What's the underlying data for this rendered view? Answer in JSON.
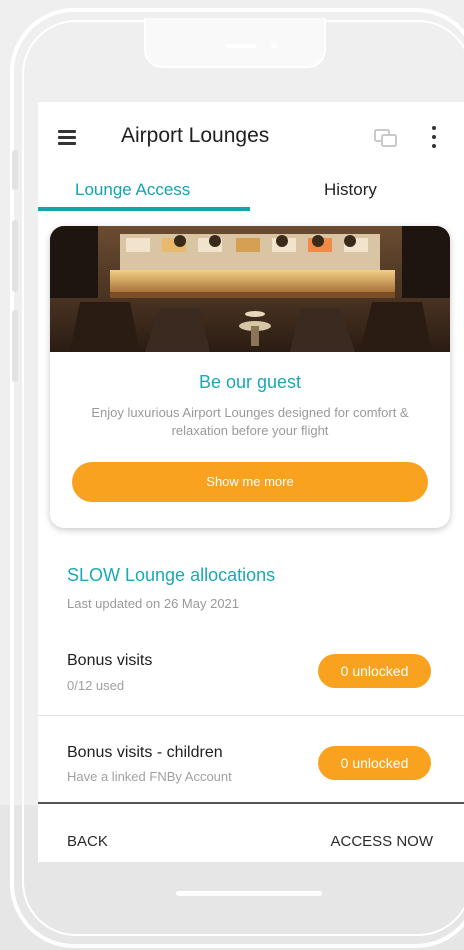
{
  "app": {
    "title": "Airport Lounges"
  },
  "tabs": [
    {
      "label": "Lounge Access",
      "active": true
    },
    {
      "label": "History",
      "active": false
    }
  ],
  "promo_card": {
    "title": "Be our guest",
    "description": "Enjoy luxurious Airport Lounges designed for comfort & relaxation before your flight",
    "button_label": "Show me more"
  },
  "allocations": {
    "title": "SLOW Lounge allocations",
    "last_updated": "Last updated on 26 May 2021",
    "items": [
      {
        "title": "Bonus visits",
        "subtitle": "0/12 used",
        "status": "0 unlocked"
      },
      {
        "title": "Bonus visits - children",
        "subtitle": "Have a linked FNBy Account",
        "status": "0 unlocked"
      }
    ]
  },
  "footer": {
    "back_label": "BACK",
    "access_label": "ACCESS NOW"
  },
  "icons": {
    "menu": "menu-icon",
    "chat": "chat-icon",
    "more": "more-vertical-icon"
  },
  "colors": {
    "accent_teal": "#14a3b0",
    "accent_orange": "#f9a21f"
  }
}
